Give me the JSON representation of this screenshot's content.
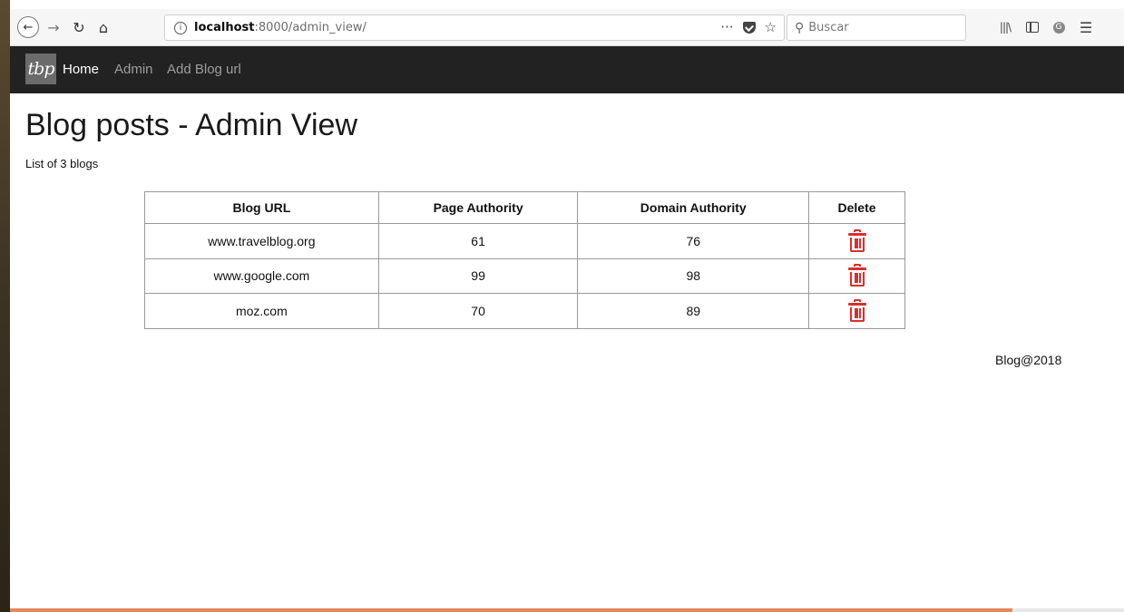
{
  "browser": {
    "url_host": "localhost",
    "url_rest": ":8000/admin_view/",
    "search_placeholder": "Buscar",
    "url_actions": "···"
  },
  "navbar": {
    "brand": "tbp",
    "links": [
      {
        "label": "Home",
        "active": true
      },
      {
        "label": "Admin",
        "active": false
      },
      {
        "label": "Add Blog url",
        "active": false
      }
    ]
  },
  "page": {
    "title": "Blog posts - Admin View",
    "count_text": "List of 3 blogs"
  },
  "table": {
    "headers": [
      "Blog URL",
      "Page Authority",
      "Domain Authority",
      "Delete"
    ],
    "rows": [
      {
        "url": "www.travelblog.org",
        "pa": "61",
        "da": "76"
      },
      {
        "url": "www.google.com",
        "pa": "99",
        "da": "98"
      },
      {
        "url": "moz.com",
        "pa": "70",
        "da": "89"
      }
    ]
  },
  "footer": {
    "text": "Blog@2018"
  },
  "colors": {
    "navbar_bg": "#222222",
    "delete_icon": "#d9302b",
    "progress": "#e8865d"
  },
  "icons": {
    "delete": "trash-icon"
  },
  "page_load_progress": 0.9
}
